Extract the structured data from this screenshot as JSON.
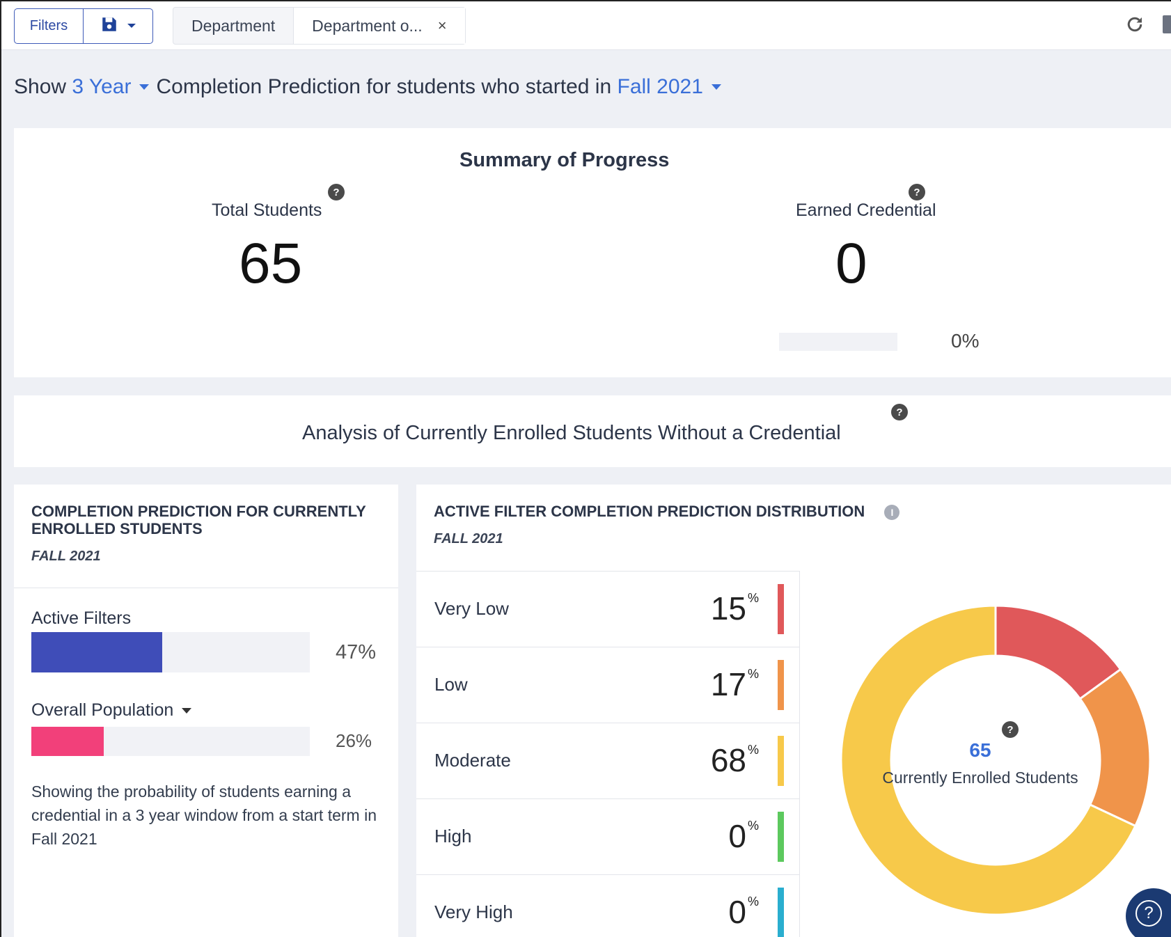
{
  "toolbar": {
    "filters_label": "Filters",
    "save_icon": "floppy-disk-icon",
    "tabs": [
      {
        "label": "Department"
      },
      {
        "label": "Department o...",
        "close": "×"
      }
    ],
    "refresh_icon": "refresh-icon"
  },
  "headline": {
    "show": "Show",
    "duration": "3 Year",
    "middle": "Completion Prediction for students who started in",
    "term": "Fall 2021"
  },
  "summary": {
    "title": "Summary of Progress",
    "total_students": {
      "label": "Total Students",
      "value": "65"
    },
    "earned_credential": {
      "label": "Earned Credential",
      "value": "0",
      "percent": "0%",
      "fill": 0
    }
  },
  "analysis": {
    "title": "Analysis of Currently Enrolled Students Without a Credential"
  },
  "completion_card": {
    "title": "COMPLETION PREDICTION FOR CURRENTLY ENROLLED STUDENTS",
    "subtitle": "FALL 2021",
    "active_filters": {
      "label": "Active Filters",
      "percent": "47%",
      "fill": 0.47,
      "color": "#3f4db8"
    },
    "overall_population": {
      "label": "Overall Population",
      "percent": "26%",
      "fill": 0.26,
      "color": "#f2407a"
    },
    "description": "Showing the probability of students earning a credential in a 3 year window from a start term in Fall 2021"
  },
  "distribution_card": {
    "title": "ACTIVE FILTER COMPLETION PREDICTION DISTRIBUTION",
    "subtitle": "FALL 2021",
    "rows": [
      {
        "label": "Very Low",
        "value": "15",
        "color": "#e0585a"
      },
      {
        "label": "Low",
        "value": "17",
        "color": "#f0944a"
      },
      {
        "label": "Moderate",
        "value": "68",
        "color": "#f7c94a"
      },
      {
        "label": "High",
        "value": "0",
        "color": "#5cc95e"
      },
      {
        "label": "Very High",
        "value": "0",
        "color": "#2aaecf"
      }
    ],
    "percent_sign": "%",
    "donut_center": {
      "value": "65",
      "label": "Currently Enrolled Students"
    }
  },
  "chart_data": {
    "type": "pie",
    "categories": [
      "Very Low",
      "Low",
      "Moderate",
      "High",
      "Very High"
    ],
    "values": [
      15,
      17,
      68,
      0,
      0
    ],
    "colors": [
      "#e0585a",
      "#f0944a",
      "#f7c94a",
      "#5cc95e",
      "#2aaecf"
    ]
  },
  "help_fab": {
    "icon": "question-icon"
  }
}
